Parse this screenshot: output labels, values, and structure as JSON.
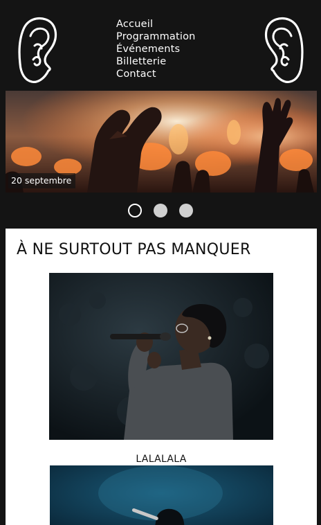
{
  "header": {
    "logo_left_icon": "ear-icon",
    "logo_right_icon": "ear-icon",
    "nav": [
      {
        "label": "Accueil"
      },
      {
        "label": "Programmation"
      },
      {
        "label": "Événements"
      },
      {
        "label": "Billetterie"
      },
      {
        "label": "Contact"
      }
    ]
  },
  "carousel": {
    "caption": "20 septembre",
    "slide_count": 3,
    "active_index": 0
  },
  "main": {
    "section_title": "À NE SURTOUT PAS MANQUER",
    "events": [
      {
        "title": "LALALALA"
      }
    ]
  },
  "colors": {
    "background": "#141414",
    "panel": "#ffffff",
    "text_dark": "#111111",
    "dot_inactive": "#d0d0d0"
  }
}
